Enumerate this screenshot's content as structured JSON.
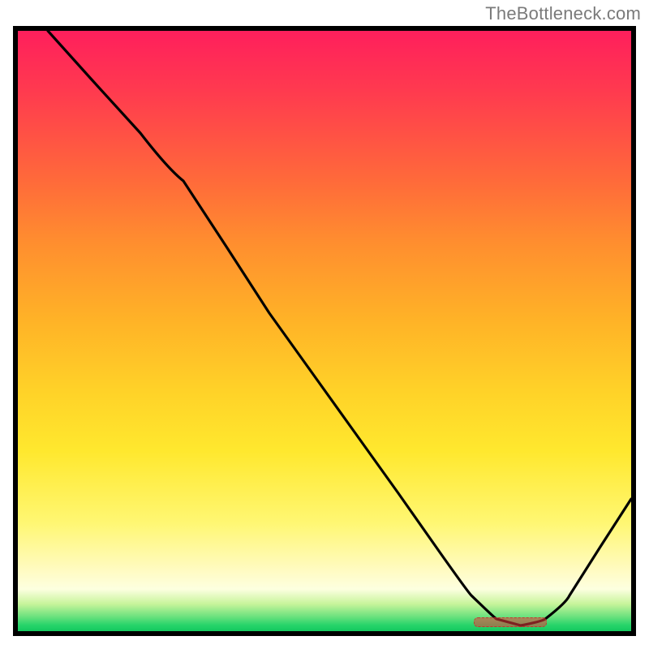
{
  "watermark": "TheBottleneck.com",
  "colors": {
    "frame": "#000000",
    "curve": "#000000",
    "marker": "#d8413f"
  },
  "chart_data": {
    "type": "line",
    "title": "",
    "xlabel": "",
    "ylabel": "",
    "xlim": [
      0,
      100
    ],
    "ylim": [
      0,
      100
    ],
    "grid": false,
    "legend": false,
    "note": "A single curve over a red→green vertical gradient. Y ≈ 100 is top (worst / red), Y ≈ 0 is bottom (best / green). The curve descends from top-left, flattens near the bottom around x ≈ 75–85, then rises toward the right edge. A small dashed red marker sits at the minimum on the bottom green band.",
    "series": [
      {
        "name": "curve",
        "x": [
          5,
          12,
          20,
          27,
          34,
          41,
          48,
          55,
          62,
          69,
          74,
          78,
          82,
          86,
          90,
          95,
          100
        ],
        "y": [
          100,
          92,
          83,
          75,
          64,
          53,
          43,
          33,
          23,
          13,
          6,
          2,
          1,
          2,
          6,
          14,
          22
        ]
      }
    ],
    "minimum_marker": {
      "x_start": 75,
      "x_end": 86,
      "y": 1
    }
  }
}
